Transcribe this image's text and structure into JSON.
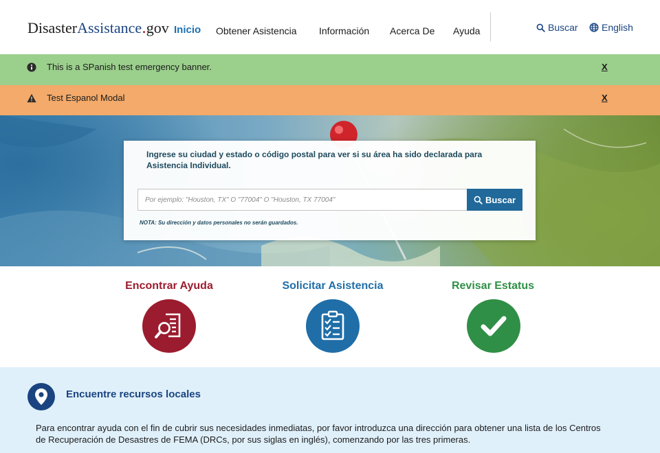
{
  "header": {
    "logo": {
      "part1": "Disaster",
      "part2": "Assistance",
      "dot": ".",
      "tld": "gov"
    },
    "nav": [
      {
        "label": "Inicio",
        "active": true
      },
      {
        "label": "Obtener Asistencia",
        "active": false
      },
      {
        "label": "Información",
        "active": false
      },
      {
        "label": "Acerca De",
        "active": false
      },
      {
        "label": "Ayuda",
        "active": false
      }
    ],
    "search_label": "Buscar",
    "language_label": "English"
  },
  "banners": [
    {
      "icon": "info-circle-icon",
      "text": "This is a SPanish test emergency banner.",
      "close": "X",
      "color": "#9bcf8c"
    },
    {
      "icon": "warning-triangle-icon",
      "text": "Test Espanol Modal",
      "close": "X",
      "color": "#f3aa6a"
    }
  ],
  "hero": {
    "prompt": "Ingrese su ciudad y estado o código postal para ver si su área ha sido declarada para Asistencia Individual.",
    "input_placeholder": "Por ejemplo: \"Houston, TX\" O \"77004\" O \"Houston, TX 77004\"",
    "button_label": "Buscar",
    "note": "NOTA: Su dirección y datos personales no serán guardados."
  },
  "quick_links": [
    {
      "title": "Encontrar Ayuda",
      "icon": "magnifier-document-icon",
      "color": "#9b1c2e"
    },
    {
      "title": "Solicitar Asistencia",
      "icon": "clipboard-checklist-icon",
      "color": "#1f6ea8"
    },
    {
      "title": "Revisar Estatus",
      "icon": "checkmark-icon",
      "color": "#2f8f46"
    }
  ],
  "resources": {
    "icon": "map-pin-icon",
    "title": "Encuentre recursos locales",
    "text": "Para encontrar ayuda con el fin de cubrir sus necesidades inmediatas, por favor introduzca una dirección para obtener una lista de los Centros de Recuperación de Desastres de FEMA (DRCs, por sus siglas en inglés), comenzando por las tres primeras."
  },
  "colors": {
    "brand_blue": "#1a4480",
    "accent_red": "#c1272d",
    "button_blue": "#20699a"
  }
}
